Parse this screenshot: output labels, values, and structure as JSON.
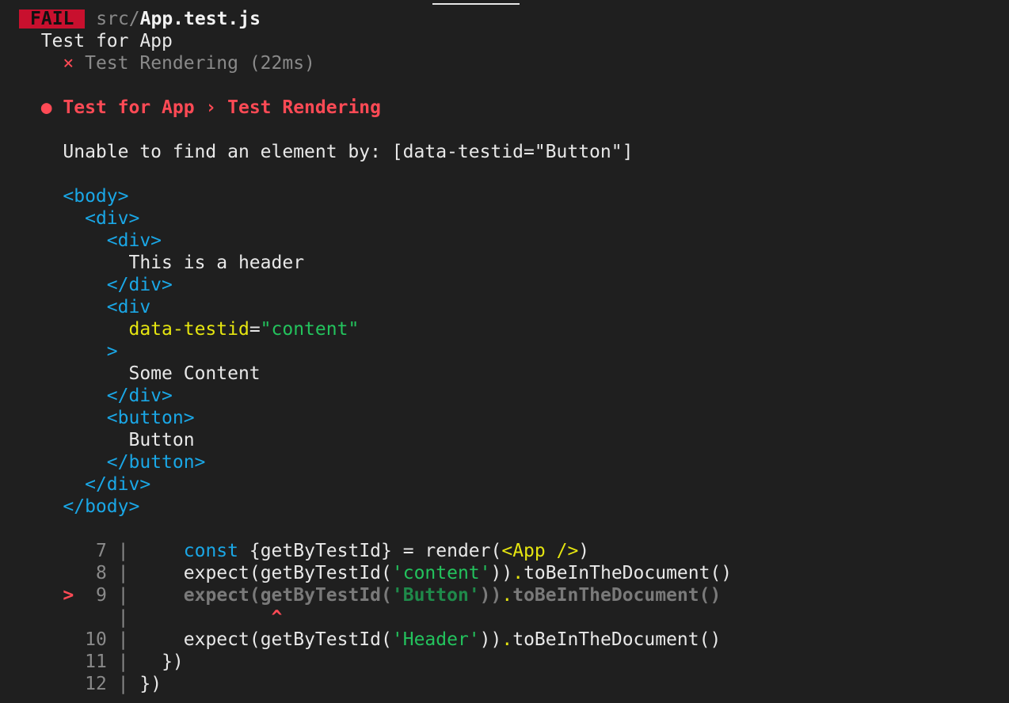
{
  "header": {
    "badge": "FAIL",
    "path_dir": "src/",
    "path_file": "App.test.js"
  },
  "suite": {
    "describe": "Test for App",
    "cross": "×",
    "test_name": "Test Rendering (22ms)"
  },
  "failure": {
    "bullet": "●",
    "title": "Test for App › Test Rendering",
    "message": "Unable to find an element by: [data-testid=\"Button\"]"
  },
  "dom": {
    "body_open": "<body>",
    "div_open": "<div>",
    "div_inner_open": "<div>",
    "header_text": "This is a header",
    "div_close_1": "</div>",
    "div_attr_open": "<div",
    "attr_name": "data-testid",
    "attr_eq": "=",
    "attr_value": "\"content\"",
    "gt": ">",
    "content_text": "Some Content",
    "div_close_2": "</div>",
    "button_open": "<button>",
    "button_text": "Button",
    "button_close": "</button>",
    "div_close_3": "</div>",
    "body_close": "</body>"
  },
  "code": {
    "l7": {
      "num": "7",
      "kw": "const",
      "a": " {getByTestId} = render(",
      "jsx": "<App />",
      "b": ")"
    },
    "l8": {
      "num": "8",
      "a": "expect(getByTestId(",
      "str": "'content'",
      "b": "))",
      "dot": ".",
      "c": "toBeInTheDocument()"
    },
    "l9": {
      "marker": ">",
      "num": "9",
      "a": "expect(getByTestId(",
      "str": "'Button'",
      "b": "))",
      "dot": ".",
      "c": "toBeInTheDocument()"
    },
    "caret": "^",
    "l10": {
      "num": "10",
      "a": "expect(getByTestId(",
      "str": "'Header'",
      "b": "))",
      "dot": ".",
      "c": "toBeInTheDocument()"
    },
    "l11": {
      "num": "11",
      "a": "})"
    },
    "l12": {
      "num": "12",
      "a": "})"
    },
    "pipe": "|"
  }
}
